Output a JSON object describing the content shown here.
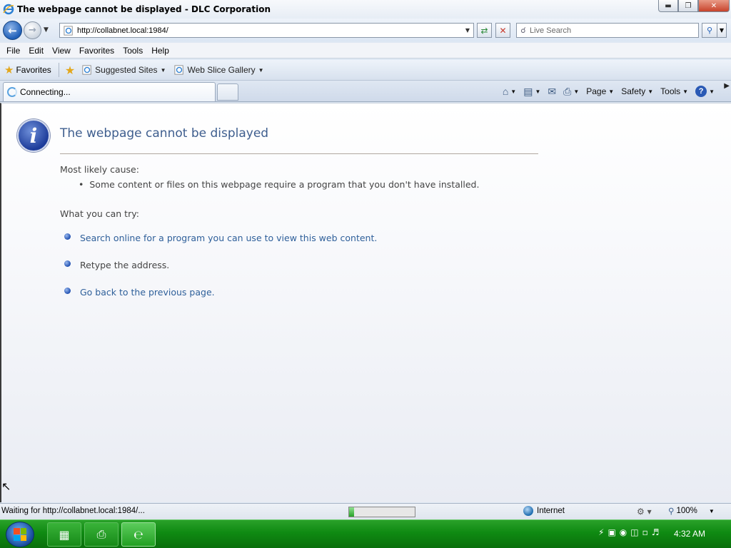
{
  "window": {
    "title": "The webpage cannot be displayed - DLC Corporation",
    "minimize_icon": "minimize-icon",
    "maximize_icon": "restore-icon",
    "close_icon": "close-icon"
  },
  "nav": {
    "url": "http://collabnet.local:1984/",
    "search_placeholder": "Live Search"
  },
  "menu": [
    "File",
    "Edit",
    "View",
    "Favorites",
    "Tools",
    "Help"
  ],
  "favorites_bar": {
    "favorites_label": "Favorites",
    "links": [
      {
        "label": "Suggested Sites"
      },
      {
        "label": "Web Slice Gallery"
      }
    ]
  },
  "tab": {
    "label": "Connecting..."
  },
  "command_bar": {
    "page": "Page",
    "safety": "Safety",
    "tools": "Tools"
  },
  "error_page": {
    "title": "The webpage cannot be displayed",
    "cause_heading": "Most likely cause:",
    "cause_item": "Some content or files on this webpage require a program that you don't have installed.",
    "try_heading": "What you can try:",
    "options": [
      {
        "text": "Search online for a program you can use to view this web content.",
        "link": true
      },
      {
        "text": "Retype the address.",
        "link": false
      },
      {
        "text": "Go back to the previous page.",
        "link": true
      }
    ]
  },
  "status_bar": {
    "text": "Waiting for http://collabnet.local:1984/...",
    "progress_fraction": 0.08,
    "zone": "Internet",
    "zoom": "100%"
  },
  "taskbar": {
    "clock": "4:32 AM"
  },
  "colors": {
    "title_text": "#3e5e8e",
    "link": "#2e5f9a",
    "taskbar": "#0f8a12"
  }
}
